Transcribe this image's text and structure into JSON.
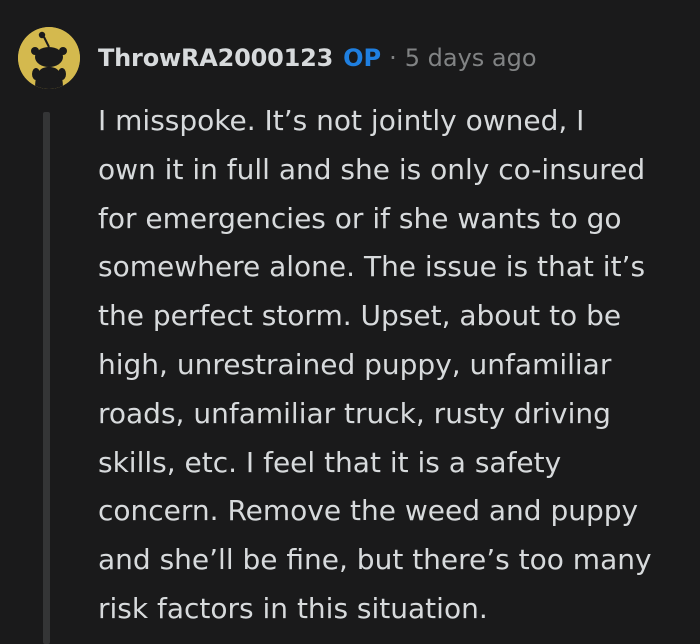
{
  "comment": {
    "author": "ThrowRA2000123",
    "op_badge": "OP",
    "separator": "·",
    "timestamp": "5 days ago",
    "avatar_icon": "snoo-avatar-icon",
    "avatar_color": "#d4b94e",
    "body_lines": [
      "I misspoke. It’s not jointly owned, I",
      "own it in full and she is only co-insured",
      "for emergencies or if she wants to go",
      "somewhere alone. The issue is that it’s",
      "the perfect storm. Upset, about to be",
      "high, unrestrained puppy, unfamiliar",
      "roads, unfamiliar truck, rusty driving",
      "skills, etc. I feel that it is a safety",
      "concern. Remove the weed and puppy",
      "and she’ll be fine, but there’s too many",
      "risk factors in this situation."
    ]
  },
  "colors": {
    "background": "#1a1a1b",
    "text": "#d7dadc",
    "muted": "#818384",
    "op": "#1f7fe0",
    "thread_line": "#343536"
  }
}
